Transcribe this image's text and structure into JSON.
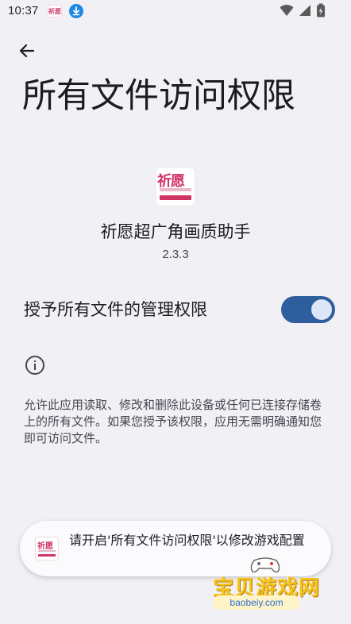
{
  "status_bar": {
    "time": "10:37",
    "app_icon_text": "祈愿",
    "icons": [
      "app-notification-icon",
      "download-icon",
      "wifi-icon",
      "cell-signal-icon",
      "battery-charging-icon"
    ]
  },
  "header": {
    "back_icon": "arrow-left-icon",
    "title": "所有文件访问权限"
  },
  "app": {
    "icon_text": "祈愿",
    "name": "祈愿超广角画质助手",
    "version": "2.3.3"
  },
  "permission": {
    "label": "授予所有文件的管理权限",
    "enabled": true
  },
  "info": {
    "icon": "info-icon",
    "description": "允许此应用读取、修改和删除此设备或任何已连接存储卷上的所有文件。如果您授予该权限，应用无需明确通知您即可访问文件。"
  },
  "toast": {
    "icon_text": "祈愿",
    "message": "请开启'所有文件访问权限'以修改游戏配置"
  },
  "watermark": {
    "text": "宝贝游戏网",
    "url": "baobeiy.com"
  },
  "colors": {
    "background": "#f1f0f5",
    "toggle_track": "#2f5e9e",
    "toggle_thumb": "#dce6f6",
    "app_brand": "#d23466",
    "watermark_yellow": "#f4c21f",
    "watermark_blue": "#2b6cd6"
  }
}
